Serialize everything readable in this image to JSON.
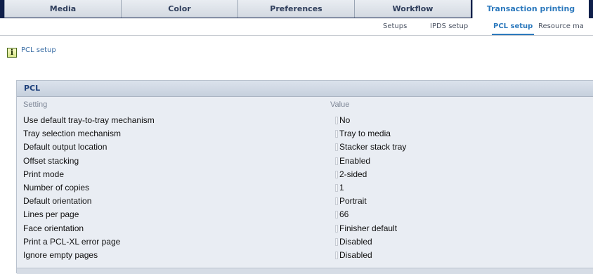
{
  "tabs": [
    {
      "label": "Media"
    },
    {
      "label": "Color"
    },
    {
      "label": "Preferences"
    },
    {
      "label": "Workflow"
    },
    {
      "label": "Transaction printing"
    }
  ],
  "subtabs": [
    {
      "label": "Setups"
    },
    {
      "label": "IPDS setup"
    },
    {
      "label": "PCL setup"
    },
    {
      "label": "Resource ma"
    }
  ],
  "page": {
    "icon": "info-icon",
    "icon_glyph": "i",
    "title": "PCL setup"
  },
  "panel": {
    "title": "PCL",
    "col_setting": "Setting",
    "col_value": "Value",
    "rows": [
      {
        "setting": "Use default tray-to-tray mechanism",
        "value": "No"
      },
      {
        "setting": "Tray selection mechanism",
        "value": "Tray to media"
      },
      {
        "setting": "Default output location",
        "value": "Stacker stack tray"
      },
      {
        "setting": "Offset stacking",
        "value": "Enabled"
      },
      {
        "setting": "Print mode",
        "value": "2-sided"
      },
      {
        "setting": "Number of copies",
        "value": "1"
      },
      {
        "setting": "Default orientation",
        "value": "Portrait"
      },
      {
        "setting": "Lines per page",
        "value": "66"
      },
      {
        "setting": "Face orientation",
        "value": "Finisher default"
      },
      {
        "setting": "Print a PCL-XL error page",
        "value": "Disabled"
      },
      {
        "setting": "Ignore empty pages",
        "value": "Disabled"
      }
    ]
  },
  "colors": {
    "tab_bar_bg": "#0f1f4a",
    "accent": "#2c79bd",
    "panel_title": "#1d3f7a"
  }
}
